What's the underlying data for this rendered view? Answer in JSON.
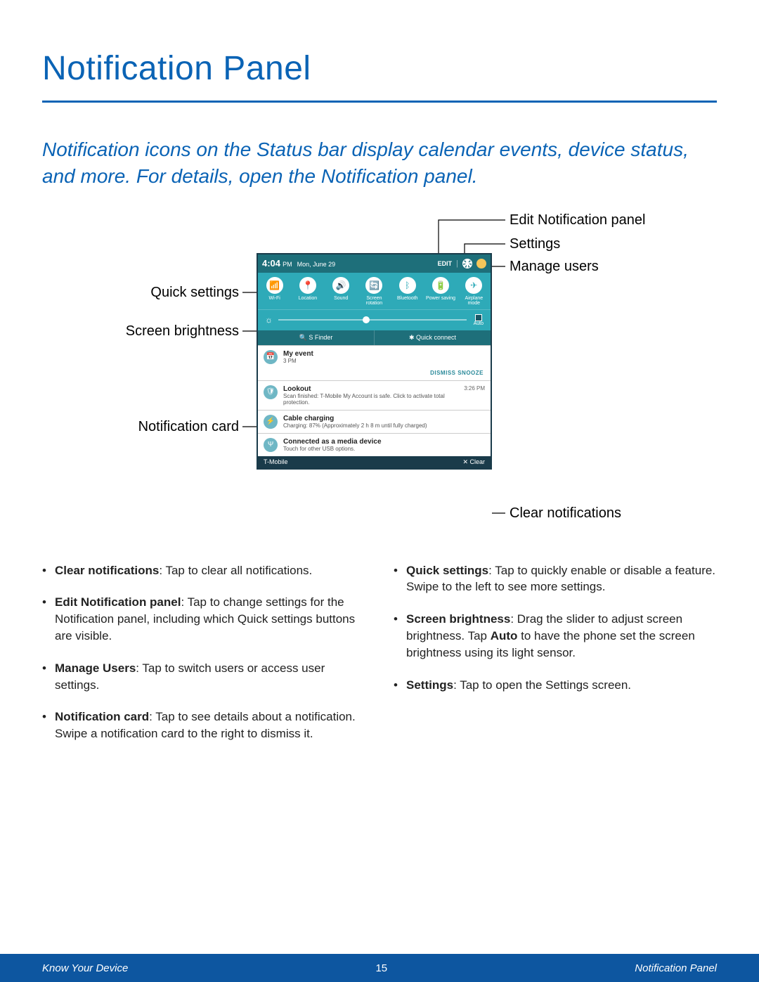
{
  "title": "Notification Panel",
  "subtitle": "Notification icons on the Status bar display calendar events, device status, and more. For details, open the Notification panel.",
  "callouts": {
    "edit_panel": "Edit Notification panel",
    "settings": "Settings",
    "manage_users": "Manage users",
    "quick_settings": "Quick settings",
    "screen_brightness": "Screen brightness",
    "notification_card": "Notification card",
    "clear_notifications": "Clear notifications"
  },
  "phone": {
    "time": "4:04",
    "ampm": "PM",
    "date": "Mon, June 29",
    "edit": "EDIT",
    "qs": [
      {
        "glyph": "📶",
        "label": "Wi-Fi"
      },
      {
        "glyph": "📍",
        "label": "Location"
      },
      {
        "glyph": "🔊",
        "label": "Sound"
      },
      {
        "glyph": "🔄",
        "label": "Screen rotation"
      },
      {
        "glyph": "ᛒ",
        "label": "Bluetooth"
      },
      {
        "glyph": "🔋",
        "label": "Power saving"
      },
      {
        "glyph": "✈",
        "label": "Airplane mode"
      }
    ],
    "auto": "Auto",
    "sfinder": "🔍  S Finder",
    "quickconnect": "✱  Quick connect",
    "cards": [
      {
        "icon": "📅",
        "title": "My event",
        "sub": "3 PM",
        "actions": "DISMISS    SNOOZE"
      },
      {
        "icon": "🛡",
        "title": "Lookout",
        "sub": "Scan finished: T-Mobile My Account is safe. Click to activate total protection.",
        "right": "3:26 PM"
      },
      {
        "icon": "⚡",
        "title": "Cable charging",
        "sub": "Charging: 87% (Approximately 2 h 8 m until fully charged)"
      },
      {
        "icon": "Ψ",
        "title": "Connected as a media device",
        "sub": "Touch for other USB options."
      }
    ],
    "carrier": "T-Mobile",
    "clear": "✕ Clear"
  },
  "bullets_left": [
    {
      "term": "Clear notifications",
      "text": ": Tap to clear all notifications."
    },
    {
      "term": "Edit Notification panel",
      "text": ": Tap to change settings for the Notification panel, including which Quick settings buttons are visible."
    },
    {
      "term": "Manage Users",
      "text": ": Tap to switch users or access user settings."
    },
    {
      "term": "Notification card",
      "text": ": Tap to see details about a notification. Swipe a notification card to the right to dismiss it."
    }
  ],
  "bullets_right": [
    {
      "term": "Quick settings",
      "text": ": Tap to quickly enable or disable a feature. Swipe to the left to see more settings."
    },
    {
      "term": "Screen brightness",
      "text": ": Drag the slider to adjust screen brightness. Tap ",
      "term2": "Auto",
      "text2": " to have the phone set the screen brightness using its light sensor."
    },
    {
      "term": "Settings",
      "text": ": Tap to open the Settings screen."
    }
  ],
  "footer": {
    "left": "Know Your Device",
    "page": "15",
    "right": "Notification Panel"
  }
}
